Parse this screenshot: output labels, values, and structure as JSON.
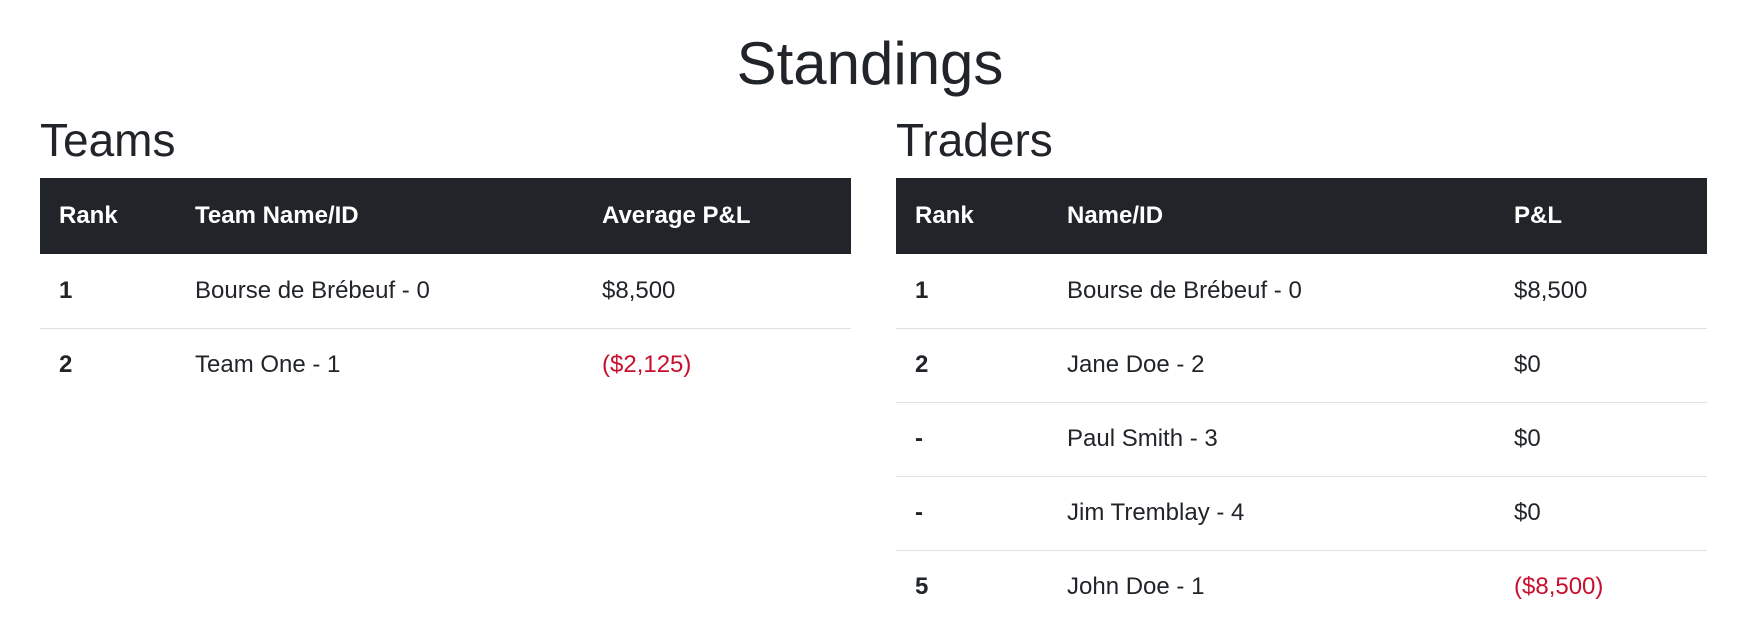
{
  "page": {
    "title": "Standings"
  },
  "colors": {
    "header_bg": "#212529",
    "negative": "#c8102e",
    "text": "#212529"
  },
  "teams": {
    "title": "Teams",
    "columns": [
      "Rank",
      "Team Name/ID",
      "Average P&L"
    ],
    "rows": [
      {
        "rank": "1",
        "name": "Bourse de Brébeuf - 0",
        "pnl": "$8,500",
        "negative": false
      },
      {
        "rank": "2",
        "name": "Team One - 1",
        "pnl": "($2,125)",
        "negative": true
      }
    ]
  },
  "traders": {
    "title": "Traders",
    "columns": [
      "Rank",
      "Name/ID",
      "P&L"
    ],
    "rows": [
      {
        "rank": "1",
        "name": "Bourse de Brébeuf - 0",
        "pnl": "$8,500",
        "negative": false
      },
      {
        "rank": "2",
        "name": "Jane Doe - 2",
        "pnl": "$0",
        "negative": false
      },
      {
        "rank": "-",
        "name": "Paul Smith - 3",
        "pnl": "$0",
        "negative": false
      },
      {
        "rank": "-",
        "name": "Jim Tremblay - 4",
        "pnl": "$0",
        "negative": false
      },
      {
        "rank": "5",
        "name": "John Doe - 1",
        "pnl": "($8,500)",
        "negative": true
      }
    ]
  }
}
